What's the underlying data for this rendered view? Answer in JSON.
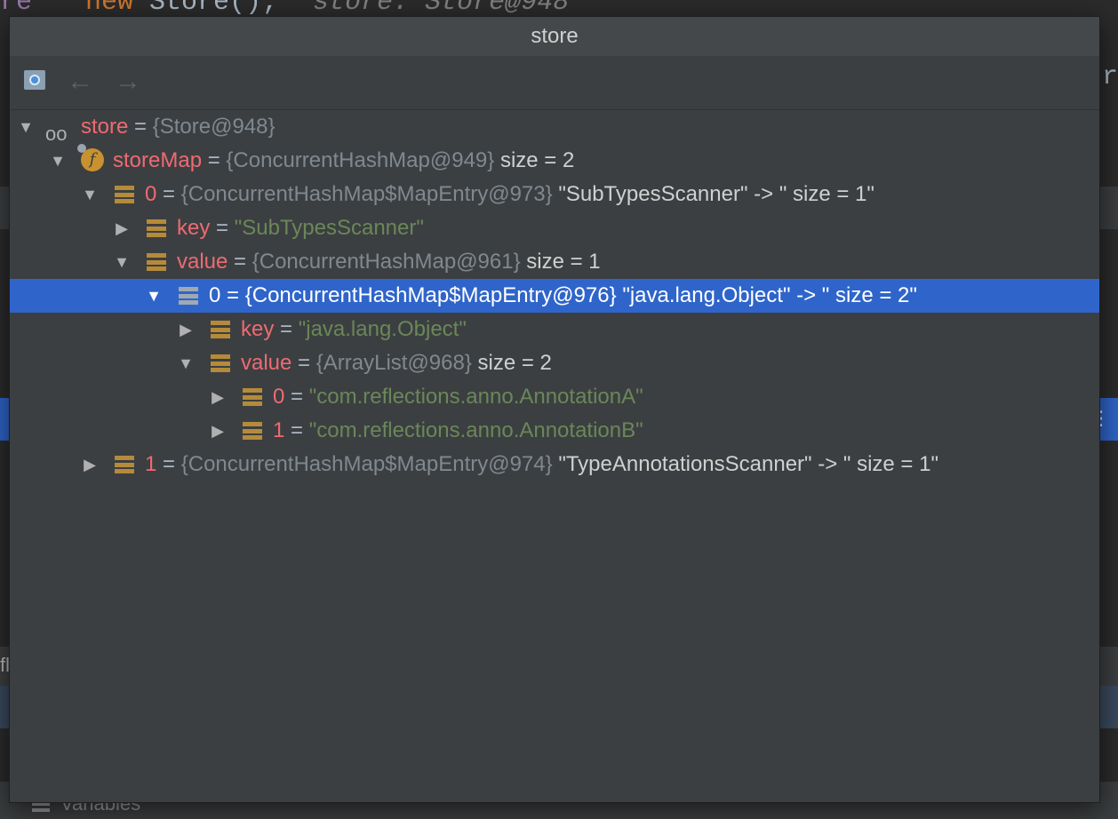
{
  "background": {
    "code_var": "re",
    "code_new": "new",
    "code_ctor": "Store();",
    "code_comment": "store: Store@948",
    "right_fragment": "nr",
    "left_fragment": "fl",
    "variables_label": "Variables"
  },
  "popup": {
    "title": "store",
    "toolbar": {
      "pin_icon": "pin-to-top-icon",
      "back_icon": "←",
      "forward_icon": "→"
    },
    "rows": [
      {
        "arrow": "▼",
        "name": "store",
        "eq": " = ",
        "type": "{Store@948}",
        "extra": ""
      },
      {
        "arrow": "▼",
        "name": "storeMap",
        "eq": " = ",
        "type": "{ConcurrentHashMap@949}",
        "extra": "  size = 2"
      },
      {
        "arrow": "▼",
        "name": "0",
        "eq": " = ",
        "type": "{ConcurrentHashMap$MapEntry@973}",
        "extra": " \"SubTypesScanner\" -> \" size = 1\""
      },
      {
        "arrow": "▶",
        "name": "key",
        "eq": " = ",
        "value": "\"SubTypesScanner\""
      },
      {
        "arrow": "▼",
        "name": "value",
        "eq": " = ",
        "type": "{ConcurrentHashMap@961}",
        "extra": "  size = 1"
      },
      {
        "arrow": "▼",
        "name": "0",
        "eq": " = ",
        "type": "{ConcurrentHashMap$MapEntry@976}",
        "extra": " \"java.lang.Object\" -> \" size = 2\""
      },
      {
        "arrow": "▶",
        "name": "key",
        "eq": " = ",
        "value": "\"java.lang.Object\""
      },
      {
        "arrow": "▼",
        "name": "value",
        "eq": " = ",
        "type": "{ArrayList@968}",
        "extra": "  size = 2"
      },
      {
        "arrow": "▶",
        "name": "0",
        "eq": " = ",
        "value": "\"com.reflections.anno.AnnotationA\""
      },
      {
        "arrow": "▶",
        "name": "1",
        "eq": " = ",
        "value": "\"com.reflections.anno.AnnotationB\""
      },
      {
        "arrow": "▶",
        "name": "1",
        "eq": " = ",
        "type": "{ConcurrentHashMap$MapEntry@974}",
        "extra": " \"TypeAnnotationsScanner\" -> \" size = 1\""
      }
    ]
  },
  "colors": {
    "selection": "#2f65ca",
    "name": "#ee6a72",
    "string": "#6a8759",
    "type": "#808890",
    "bars_icon": "#b58a3a"
  }
}
